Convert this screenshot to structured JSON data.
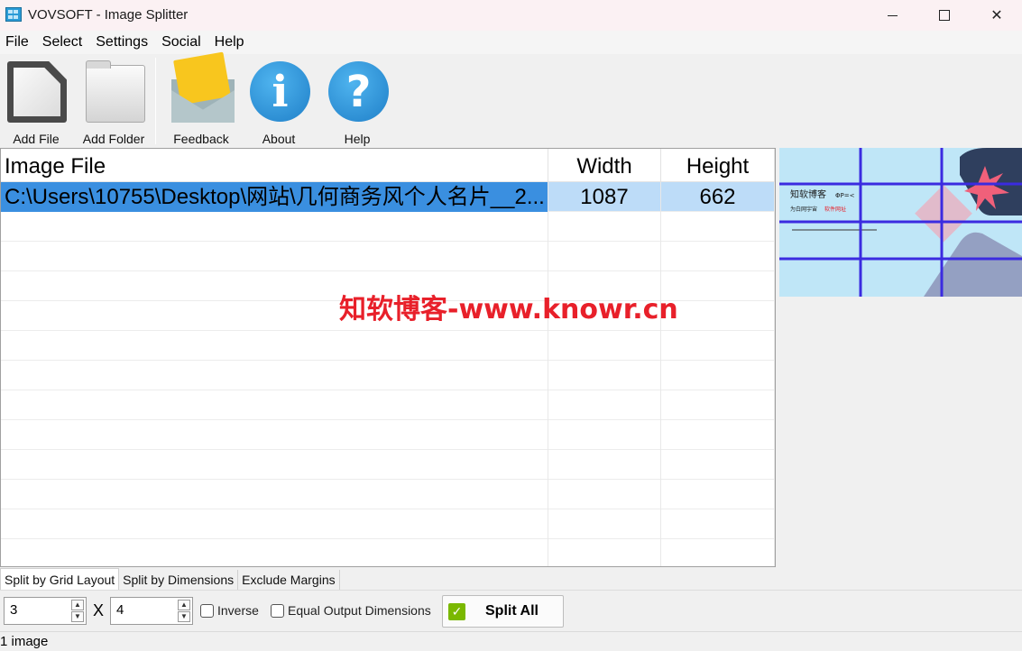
{
  "window": {
    "title": "VOVSOFT - Image Splitter",
    "minimize_glyph": "",
    "maximize_glyph": "",
    "close_glyph": "✕"
  },
  "menu": [
    "File",
    "Select",
    "Settings",
    "Social",
    "Help"
  ],
  "toolbar": {
    "add_file": "Add File",
    "add_folder": "Add Folder",
    "feedback": "Feedback",
    "about": "About",
    "help": "Help",
    "about_glyph": "i",
    "help_glyph": "?"
  },
  "grid": {
    "columns": [
      "Image File",
      "Width",
      "Height"
    ],
    "rows": [
      {
        "file": "C:\\Users\\10755\\Desktop\\网站\\几何商务风个人名片__2...",
        "width": "1087",
        "height": "662"
      }
    ]
  },
  "watermark": "知软博客-www.knowr.cn",
  "preview": {
    "title_text": "知软博客",
    "sub_text": "ΦP=<",
    "line1": "为白网宇宙",
    "line2": "软件网址",
    "accent_red": "#e8202a",
    "grid_line_color": "#3b2be0"
  },
  "tabs": [
    "Split by Grid Layout",
    "Split by Dimensions",
    "Exclude Margins"
  ],
  "options": {
    "rows_value": "3",
    "cols_value": "4",
    "separator": "X",
    "inverse_label": "Inverse",
    "equal_output_label": "Equal Output Dimensions",
    "split_all_label": "Split All",
    "split_check_glyph": "✓",
    "spin_up": "▲",
    "spin_down": "▼"
  },
  "status": "1 image",
  "colors": {
    "selection": "#bddcf8",
    "selected_cell": "#3a8fe0",
    "info_blue": "#1f7fc8",
    "envelope_yellow": "#f8c61e"
  }
}
